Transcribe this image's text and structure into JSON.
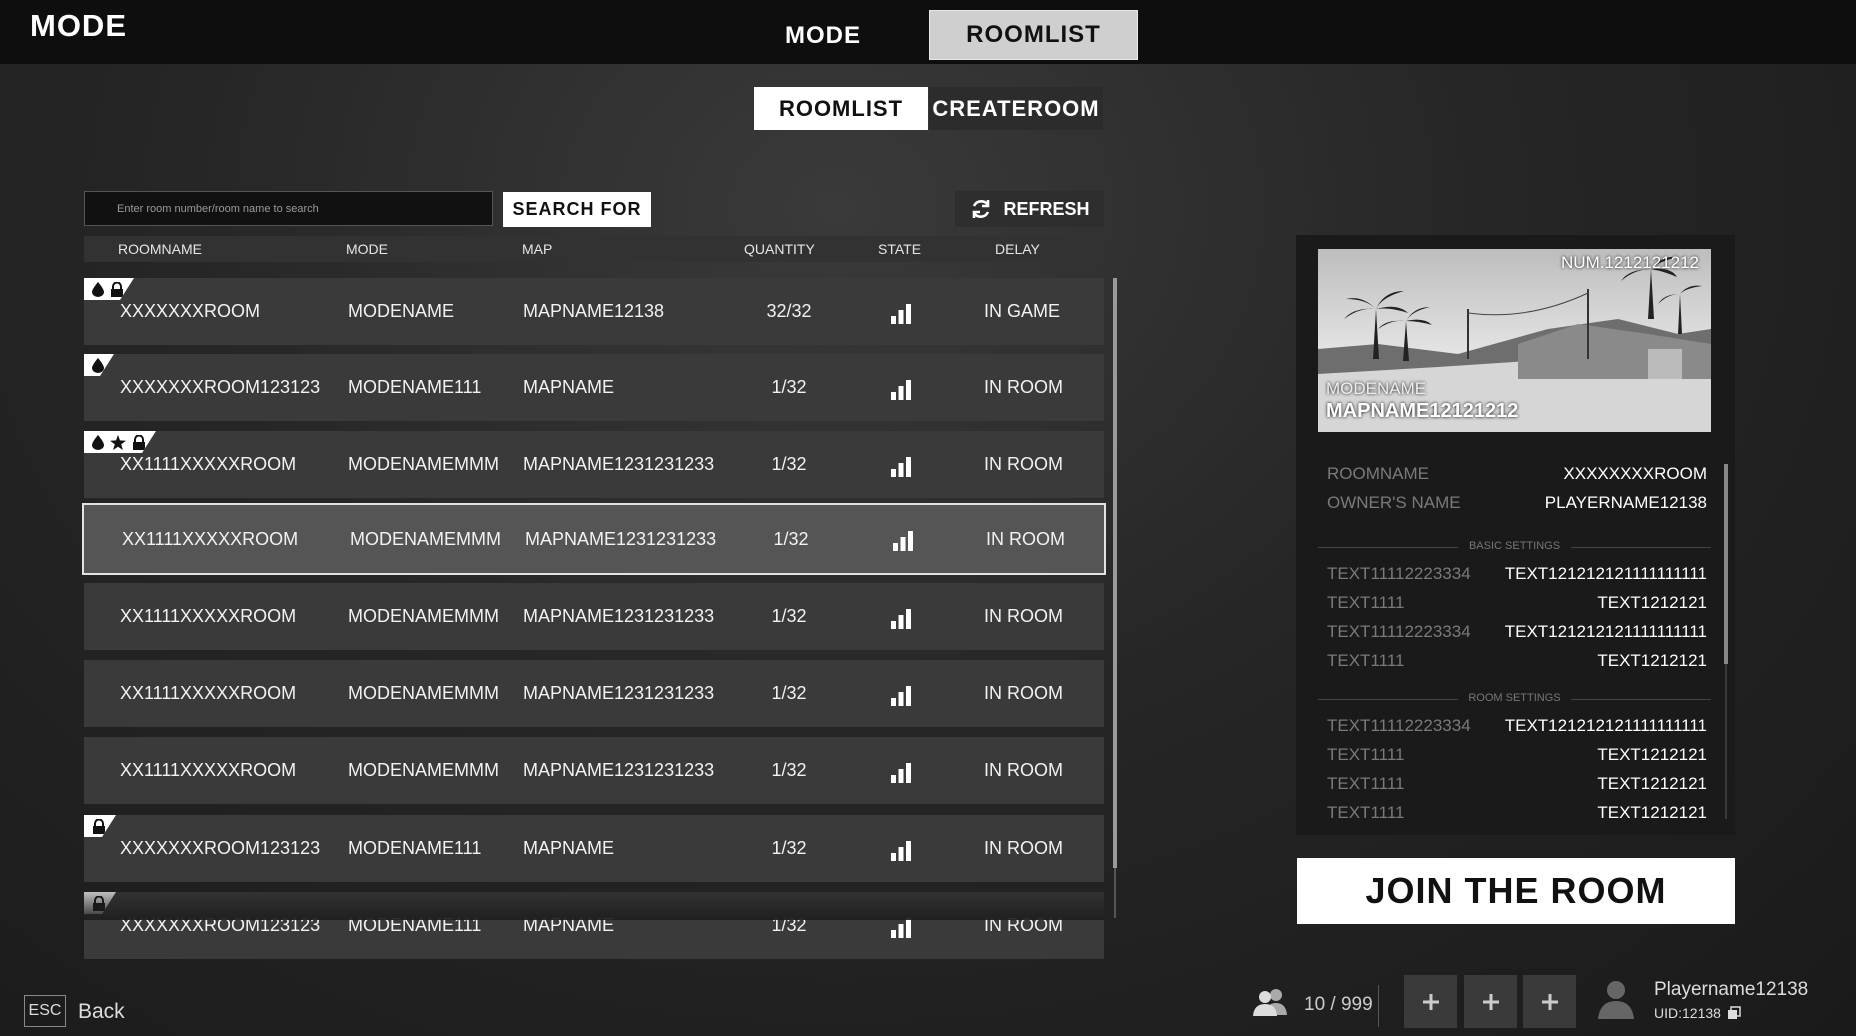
{
  "header": {
    "title": "MODE",
    "tabs": [
      {
        "label": "MODE"
      },
      {
        "label": "ROOMLIST"
      }
    ],
    "active_tab": "ROOMLIST"
  },
  "subtabs": [
    {
      "label": "ROOMLIST"
    },
    {
      "label": "CREATEROOM"
    }
  ],
  "search": {
    "placeholder": "Enter room number/room name to search",
    "value": "",
    "button_label": "SEARCH FOR",
    "refresh_label": "REFRESH"
  },
  "table": {
    "columns": [
      "ROOMNAME",
      "MODE",
      "MAP",
      "QUANTITY",
      "STATE",
      "DELAY"
    ],
    "rows": [
      {
        "roomname": "XXXXXXXROOM",
        "mode": "MODENAME",
        "map": "MAPNAME12138",
        "quantity": "32/32",
        "delay": "IN GAME",
        "icons": [
          "drop-icon",
          "lock-icon"
        ]
      },
      {
        "roomname": "XXXXXXXROOM123123",
        "mode": "MODENAME111",
        "map": "MAPNAME",
        "quantity": "1/32",
        "delay": "IN ROOM",
        "icons": [
          "drop-icon"
        ]
      },
      {
        "roomname": "XX1111XXXXXROOM",
        "mode": "MODENAMEMMM",
        "map": "MAPNAME1231231233",
        "quantity": "1/32",
        "delay": "IN ROOM",
        "icons": [
          "drop-icon",
          "star-icon",
          "lock-icon"
        ]
      },
      {
        "roomname": "XX1111XXXXXROOM",
        "mode": "MODENAMEMMM",
        "map": "MAPNAME1231231233",
        "quantity": "1/32",
        "delay": "IN ROOM",
        "icons": [],
        "selected": true
      },
      {
        "roomname": "XX1111XXXXXROOM",
        "mode": "MODENAMEMMM",
        "map": "MAPNAME1231231233",
        "quantity": "1/32",
        "delay": "IN ROOM",
        "icons": []
      },
      {
        "roomname": "XX1111XXXXXROOM",
        "mode": "MODENAMEMMM",
        "map": "MAPNAME1231231233",
        "quantity": "1/32",
        "delay": "IN ROOM",
        "icons": []
      },
      {
        "roomname": "XX1111XXXXXROOM",
        "mode": "MODENAMEMMM",
        "map": "MAPNAME1231231233",
        "quantity": "1/32",
        "delay": "IN ROOM",
        "icons": []
      },
      {
        "roomname": "XXXXXXXROOM123123",
        "mode": "MODENAME111",
        "map": "MAPNAME",
        "quantity": "1/32",
        "delay": "IN ROOM",
        "icons": [
          "lock-icon"
        ]
      },
      {
        "roomname": "XXXXXXXROOM123123",
        "mode": "MODENAME111",
        "map": "MAPNAME",
        "quantity": "1/32",
        "delay": "IN ROOM",
        "icons": [
          "lock-icon"
        ]
      }
    ]
  },
  "detail": {
    "room_num": "NUM.1212121212",
    "mode_name": "MODENAME",
    "map_name": "MAPNAME12121212",
    "info": [
      {
        "key": "ROOMNAME",
        "value": "XXXXXXXXROOM"
      },
      {
        "key": "OWNER'S NAME",
        "value": "PLAYERNAME12138"
      }
    ],
    "basic_settings_title": "BASIC SETTINGS",
    "basic_settings": [
      {
        "key": "TEXT11112223334",
        "value": "TEXT121212121111111111"
      },
      {
        "key": "TEXT1111",
        "value": "TEXT1212121"
      },
      {
        "key": "TEXT11112223334",
        "value": "TEXT121212121111111111"
      },
      {
        "key": "TEXT1111",
        "value": "TEXT1212121"
      }
    ],
    "room_settings_title": "ROOM SETTINGS",
    "room_settings": [
      {
        "key": "TEXT11112223334",
        "value": "TEXT121212121111111111"
      },
      {
        "key": "TEXT1111",
        "value": "TEXT1212121"
      },
      {
        "key": "TEXT1111",
        "value": "TEXT1212121"
      },
      {
        "key": "TEXT1111",
        "value": "TEXT1212121"
      }
    ],
    "join_label": "JOIN THE ROOM"
  },
  "footer": {
    "esc_key": "ESC",
    "back_label": "Back",
    "players_count": "10 / 999",
    "player_name": "Playername12138",
    "player_uid": "UID:12138"
  },
  "colors": {
    "topbar": "#0e0e0e",
    "row": "#3a3a3a",
    "row_selected": "#555555",
    "accent_white": "#ffffff"
  }
}
